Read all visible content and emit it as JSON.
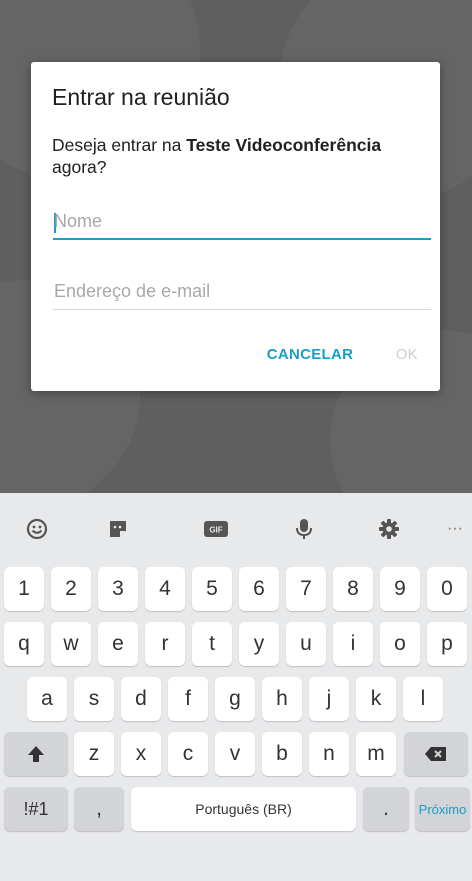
{
  "dialog": {
    "title": "Entrar na reunião",
    "message_prefix": "Deseja entrar na ",
    "meeting_name": "Teste Videoconferência",
    "message_suffix": " agora?",
    "name_placeholder": "Nome",
    "email_placeholder": "Endereço de e-mail",
    "cancel_label": "CANCELAR",
    "ok_label": "OK"
  },
  "keyboard": {
    "toolbar_icons": [
      "emoji-icon",
      "sticker-icon",
      "gif-icon",
      "microphone-icon",
      "settings-icon",
      "more-icon"
    ],
    "gif_label": "GIF",
    "more_label": "···",
    "row_numbers": [
      "1",
      "2",
      "3",
      "4",
      "5",
      "6",
      "7",
      "8",
      "9",
      "0"
    ],
    "row1": [
      "q",
      "w",
      "e",
      "r",
      "t",
      "y",
      "u",
      "i",
      "o",
      "p"
    ],
    "row2": [
      "a",
      "s",
      "d",
      "f",
      "g",
      "h",
      "j",
      "k",
      "l"
    ],
    "row3": [
      "z",
      "x",
      "c",
      "v",
      "b",
      "n",
      "m"
    ],
    "symbols_label": "!#1",
    "comma_label": ",",
    "space_label": "Português (BR)",
    "period_label": ".",
    "next_label": "Próximo"
  },
  "colors": {
    "accent": "#1a9ec8",
    "backdrop": "#5f5f5f",
    "keyboard_bg": "#e8e9eb"
  }
}
